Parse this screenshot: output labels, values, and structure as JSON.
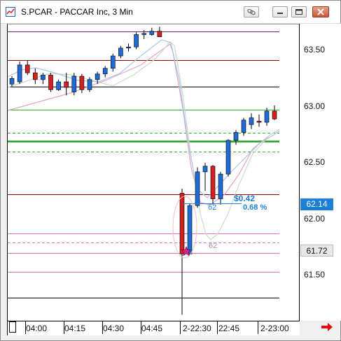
{
  "window": {
    "title": "S.PCAR - PACCAR Inc, 3 Min",
    "buttons": [
      "link-icon",
      "minimize-icon",
      "restore-icon",
      "close-icon"
    ]
  },
  "price_axis": {
    "ticks": [
      "63.50",
      "63.00",
      "62.50",
      "62.00",
      "61.50"
    ],
    "current_price": "62.14",
    "marker_price": "61.72"
  },
  "time_axis": {
    "labels": [
      "04:00",
      "04:15",
      "04:30",
      "04:45",
      "2-22:30",
      "22:45",
      "2-23:00"
    ]
  },
  "measure": {
    "amount": "$0.42",
    "percent": "0.68 %",
    "bars": "62",
    "bars_ghost": "62"
  },
  "colors": {
    "up": "#1f6bd6",
    "down": "#d42020",
    "ma_fast": "#a9c6ea",
    "ma_mid": "#c8ddc8",
    "ma_slow": "#e6a3c4",
    "line_green": "#28b428",
    "line_red": "#8b0000",
    "line_magenta": "#d67ad6",
    "measure": "#1e7fd8"
  },
  "chart_data": {
    "type": "candlestick",
    "y_range": [
      61.3,
      63.85
    ],
    "candles": [
      {
        "o": 63.2,
        "h": 63.27,
        "l": 63.18,
        "c": 63.25
      },
      {
        "o": 63.22,
        "h": 63.4,
        "l": 63.2,
        "c": 63.37
      },
      {
        "o": 63.37,
        "h": 63.41,
        "l": 63.28,
        "c": 63.3
      },
      {
        "o": 63.3,
        "h": 63.34,
        "l": 63.2,
        "c": 63.24
      },
      {
        "o": 63.24,
        "h": 63.3,
        "l": 63.2,
        "c": 63.28
      },
      {
        "o": 63.28,
        "h": 63.3,
        "l": 63.13,
        "c": 63.15
      },
      {
        "o": 63.15,
        "h": 63.24,
        "l": 63.14,
        "c": 63.22
      },
      {
        "o": 63.22,
        "h": 63.3,
        "l": 63.1,
        "c": 63.17
      },
      {
        "o": 63.13,
        "h": 63.3,
        "l": 63.1,
        "c": 63.27
      },
      {
        "o": 63.27,
        "h": 63.29,
        "l": 63.12,
        "c": 63.15
      },
      {
        "o": 63.15,
        "h": 63.26,
        "l": 63.13,
        "c": 63.24
      },
      {
        "o": 63.24,
        "h": 63.31,
        "l": 63.2,
        "c": 63.29
      },
      {
        "o": 63.29,
        "h": 63.36,
        "l": 63.26,
        "c": 63.34
      },
      {
        "o": 63.34,
        "h": 63.47,
        "l": 63.31,
        "c": 63.45
      },
      {
        "o": 63.45,
        "h": 63.54,
        "l": 63.43,
        "c": 63.52
      },
      {
        "o": 63.52,
        "h": 63.56,
        "l": 63.49,
        "c": 63.53
      },
      {
        "o": 63.53,
        "h": 63.66,
        "l": 63.51,
        "c": 63.64
      },
      {
        "o": 63.64,
        "h": 63.68,
        "l": 63.6,
        "c": 63.65
      },
      {
        "o": 63.64,
        "h": 63.7,
        "l": 63.63,
        "c": 63.67
      },
      {
        "o": 63.67,
        "h": 63.71,
        "l": 63.62,
        "c": 63.62
      },
      {
        "o": 62.23,
        "h": 62.27,
        "l": 61.15,
        "c": 61.69
      },
      {
        "o": 61.69,
        "h": 62.14,
        "l": 61.68,
        "c": 62.12
      },
      {
        "o": 62.12,
        "h": 62.46,
        "l": 62.1,
        "c": 62.42
      },
      {
        "o": 62.42,
        "h": 62.5,
        "l": 62.25,
        "c": 62.47
      },
      {
        "o": 62.47,
        "h": 62.48,
        "l": 62.13,
        "c": 62.18
      },
      {
        "o": 62.18,
        "h": 62.42,
        "l": 62.13,
        "c": 62.4
      },
      {
        "o": 62.4,
        "h": 62.71,
        "l": 62.38,
        "c": 62.7
      },
      {
        "o": 62.7,
        "h": 62.79,
        "l": 62.66,
        "c": 62.77
      },
      {
        "o": 62.77,
        "h": 62.9,
        "l": 62.74,
        "c": 62.88
      },
      {
        "o": 62.84,
        "h": 62.94,
        "l": 62.8,
        "c": 62.9
      },
      {
        "o": 62.87,
        "h": 62.93,
        "l": 62.82,
        "c": 62.86
      },
      {
        "o": 62.86,
        "h": 62.99,
        "l": 62.83,
        "c": 62.96
      },
      {
        "o": 62.96,
        "h": 63.01,
        "l": 62.88,
        "c": 62.89
      }
    ],
    "horizontal_lines": [
      {
        "price": 63.67,
        "color": "#7a1a7a",
        "style": "solid"
      },
      {
        "price": 63.41,
        "color": "#8b0000",
        "style": "solid"
      },
      {
        "price": 63.18,
        "color": "#000000",
        "style": "solid"
      },
      {
        "price": 62.97,
        "color": "#28b428",
        "style": "solid"
      },
      {
        "price": 62.77,
        "color": "#28b428",
        "style": "dashed"
      },
      {
        "price": 62.69,
        "color": "#1fa01f",
        "style": "thick"
      },
      {
        "price": 62.6,
        "color": "#28b428",
        "style": "dashed"
      },
      {
        "price": 62.22,
        "color": "#8b0000",
        "style": "solid"
      },
      {
        "price": 61.87,
        "color": "#e070d0",
        "style": "solid"
      },
      {
        "price": 61.79,
        "color": "#e070d0",
        "style": "dashed"
      },
      {
        "price": 61.7,
        "color": "#e070d0",
        "style": "solid"
      },
      {
        "price": 61.53,
        "color": "#e070d0",
        "style": "solid"
      },
      {
        "price": 61.3,
        "color": "#000000",
        "style": "solid"
      }
    ]
  }
}
